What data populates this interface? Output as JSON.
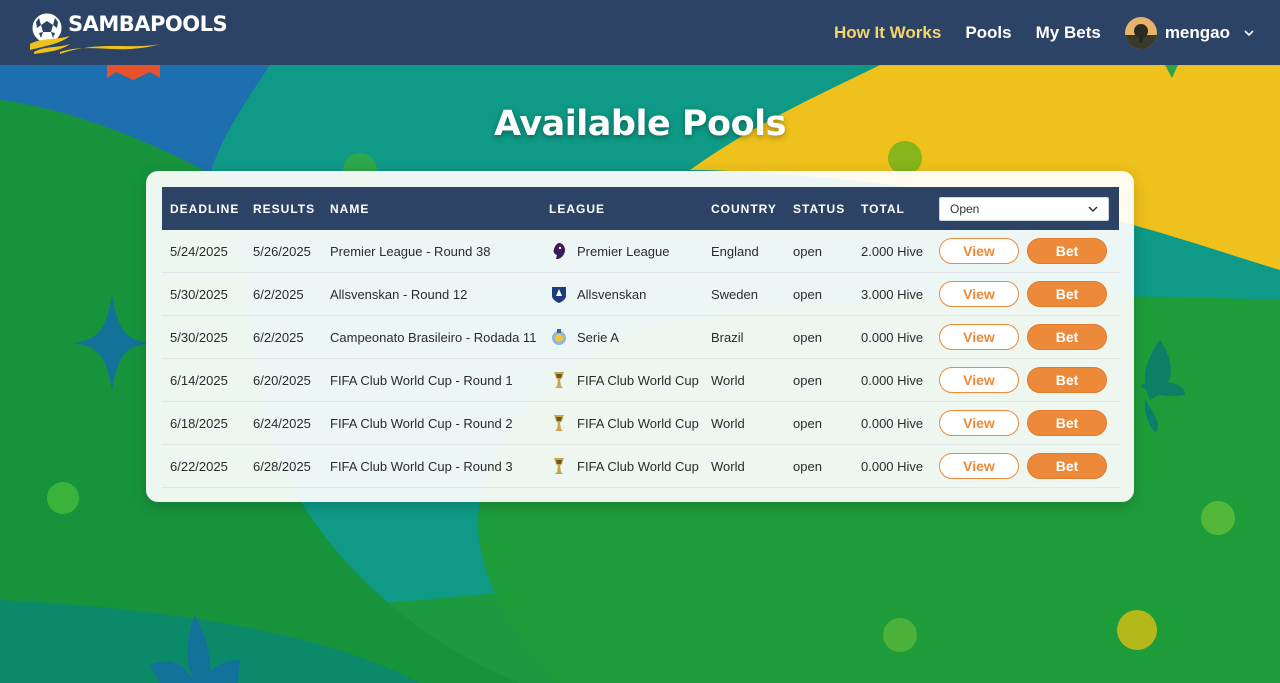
{
  "brand": {
    "name": "SAMBAPOOLS"
  },
  "nav": {
    "links": [
      {
        "label": "How It Works",
        "active": true
      },
      {
        "label": "Pools",
        "active": false
      },
      {
        "label": "My Bets",
        "active": false
      }
    ],
    "user": {
      "name": "mengao"
    }
  },
  "page": {
    "title": "Available Pools"
  },
  "table": {
    "headers": [
      "DEADLINE",
      "RESULTS",
      "NAME",
      "LEAGUE",
      "COUNTRY",
      "STATUS",
      "TOTAL"
    ],
    "filter": {
      "selected": "Open"
    },
    "view_label": "View",
    "bet_label": "Bet",
    "rows": [
      {
        "deadline": "5/24/2025",
        "results": "5/26/2025",
        "name": "Premier League - Round 38",
        "league": "Premier League",
        "league_icon": "premier-league-icon",
        "country": "England",
        "status": "open",
        "total": "2.000 Hive"
      },
      {
        "deadline": "5/30/2025",
        "results": "6/2/2025",
        "name": "Allsvenskan - Round 12",
        "league": "Allsvenskan",
        "league_icon": "allsvenskan-icon",
        "country": "Sweden",
        "status": "open",
        "total": "3.000 Hive"
      },
      {
        "deadline": "5/30/2025",
        "results": "6/2/2025",
        "name": "Campeonato Brasileiro - Rodada 11",
        "league": "Serie A",
        "league_icon": "serie-a-icon",
        "country": "Brazil",
        "status": "open",
        "total": "0.000 Hive"
      },
      {
        "deadline": "6/14/2025",
        "results": "6/20/2025",
        "name": "FIFA Club World Cup - Round 1",
        "league": "FIFA Club World Cup",
        "league_icon": "trophy-icon",
        "country": "World",
        "status": "open",
        "total": "0.000 Hive"
      },
      {
        "deadline": "6/18/2025",
        "results": "6/24/2025",
        "name": "FIFA Club World Cup - Round 2",
        "league": "FIFA Club World Cup",
        "league_icon": "trophy-icon",
        "country": "World",
        "status": "open",
        "total": "0.000 Hive"
      },
      {
        "deadline": "6/22/2025",
        "results": "6/28/2025",
        "name": "FIFA Club World Cup - Round 3",
        "league": "FIFA Club World Cup",
        "league_icon": "trophy-icon",
        "country": "World",
        "status": "open",
        "total": "0.000 Hive"
      }
    ]
  },
  "colors": {
    "nav_bg": "#2c4366",
    "accent": "#ec8a3a",
    "active_link": "#f7d46a"
  }
}
